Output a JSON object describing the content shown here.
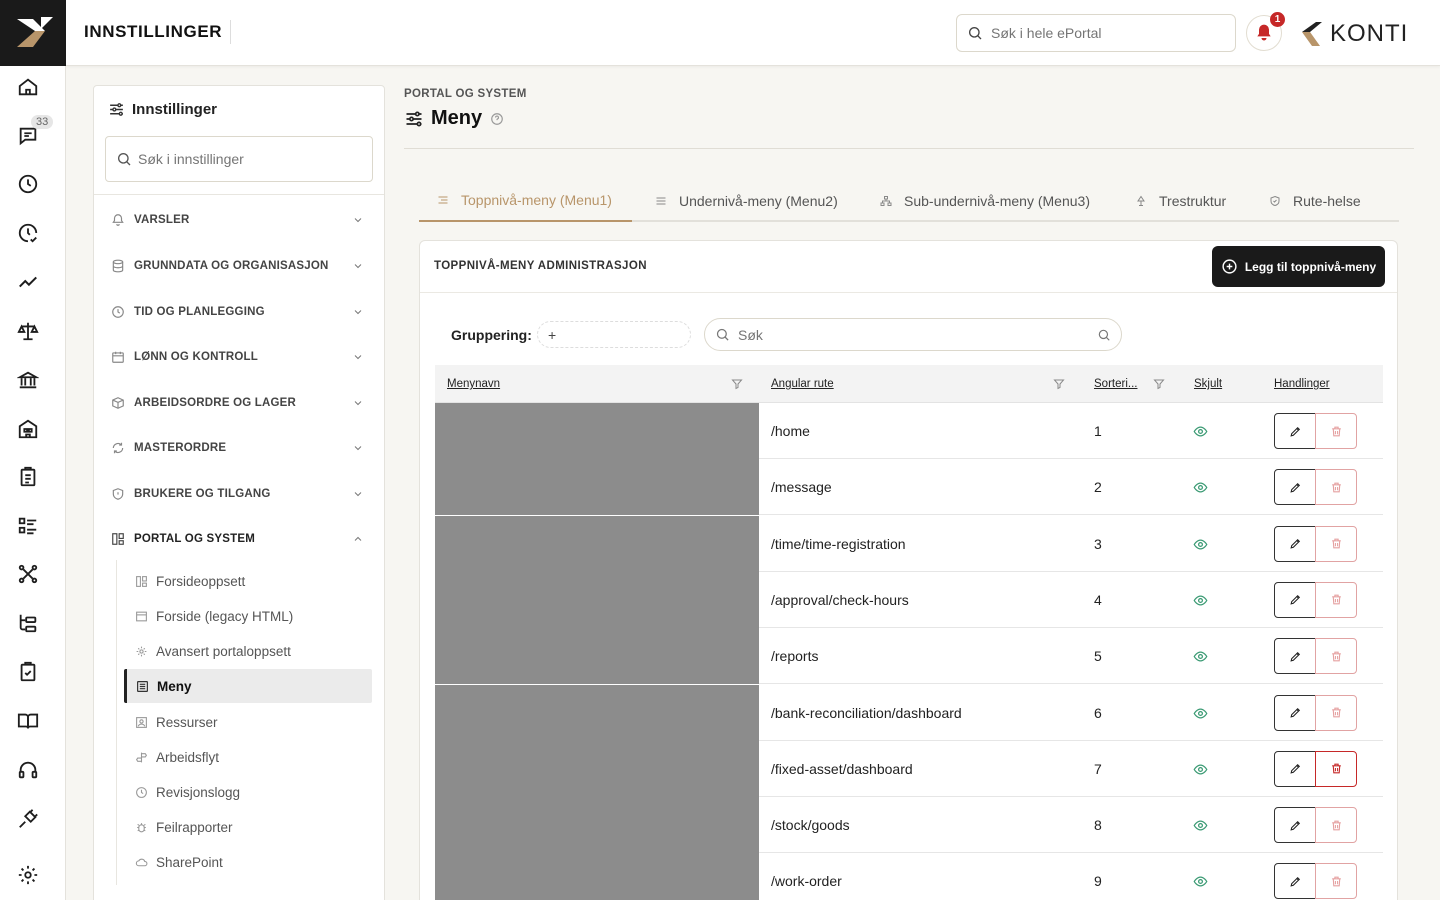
{
  "header": {
    "title": "INNSTILLINGER",
    "search_placeholder": "Søk i hele ePortal",
    "notification_count": "1",
    "brand_text": "KONTI"
  },
  "rail": {
    "message_badge": "33"
  },
  "settings": {
    "title": "Innstillinger",
    "search_placeholder": "Søk i innstillinger",
    "groups": [
      {
        "label": "VARSLER"
      },
      {
        "label": "GRUNNDATA OG ORGANISASJON"
      },
      {
        "label": "TID OG PLANLEGGING"
      },
      {
        "label": "LØNN OG KONTROLL"
      },
      {
        "label": "ARBEIDSORDRE OG LAGER"
      },
      {
        "label": "MASTERORDRE"
      },
      {
        "label": "BRUKERE OG TILGANG"
      },
      {
        "label": "PORTAL OG SYSTEM"
      }
    ],
    "sub_items": [
      {
        "label": "Forsideoppsett"
      },
      {
        "label": "Forside (legacy HTML)"
      },
      {
        "label": "Avansert portaloppsett"
      },
      {
        "label": "Meny"
      },
      {
        "label": "Ressurser"
      },
      {
        "label": "Arbeidsflyt"
      },
      {
        "label": "Revisjonslogg"
      },
      {
        "label": "Feilrapporter"
      },
      {
        "label": "SharePoint"
      }
    ]
  },
  "main": {
    "breadcrumb": "PORTAL OG SYSTEM",
    "title": "Meny",
    "tabs": [
      {
        "label": "Toppnivå-meny (Menu1)"
      },
      {
        "label": "Undernivå-meny (Menu2)"
      },
      {
        "label": "Sub-undernivå-meny (Menu3)"
      },
      {
        "label": "Trestruktur"
      },
      {
        "label": "Rute-helse"
      }
    ],
    "card": {
      "title": "TOPPNIVÅ-MENY ADMINISTRASJON",
      "add_button": "Legg til toppnivå-meny",
      "grouping_label": "Gruppering:",
      "grouping_value": "+",
      "search_placeholder": "Søk"
    },
    "table": {
      "columns": [
        "Menynavn",
        "Angular rute",
        "Sorteri...",
        "Skjult",
        "Handlinger"
      ],
      "rows": [
        {
          "route": "/home",
          "sort": "1"
        },
        {
          "route": "/message",
          "sort": "2"
        },
        {
          "route": "/time/time-registration",
          "sort": "3"
        },
        {
          "route": "/approval/check-hours",
          "sort": "4"
        },
        {
          "route": "/reports",
          "sort": "5"
        },
        {
          "route": "/bank-reconciliation/dashboard",
          "sort": "6"
        },
        {
          "route": "/fixed-asset/dashboard",
          "sort": "7"
        },
        {
          "route": "/stock/goods",
          "sort": "8"
        },
        {
          "route": "/work-order",
          "sort": "9"
        }
      ]
    }
  },
  "colors": {
    "accent": "#b8956a",
    "dark": "#1a1a1a",
    "danger": "#c62828",
    "visible_eye": "#3a9a73"
  }
}
